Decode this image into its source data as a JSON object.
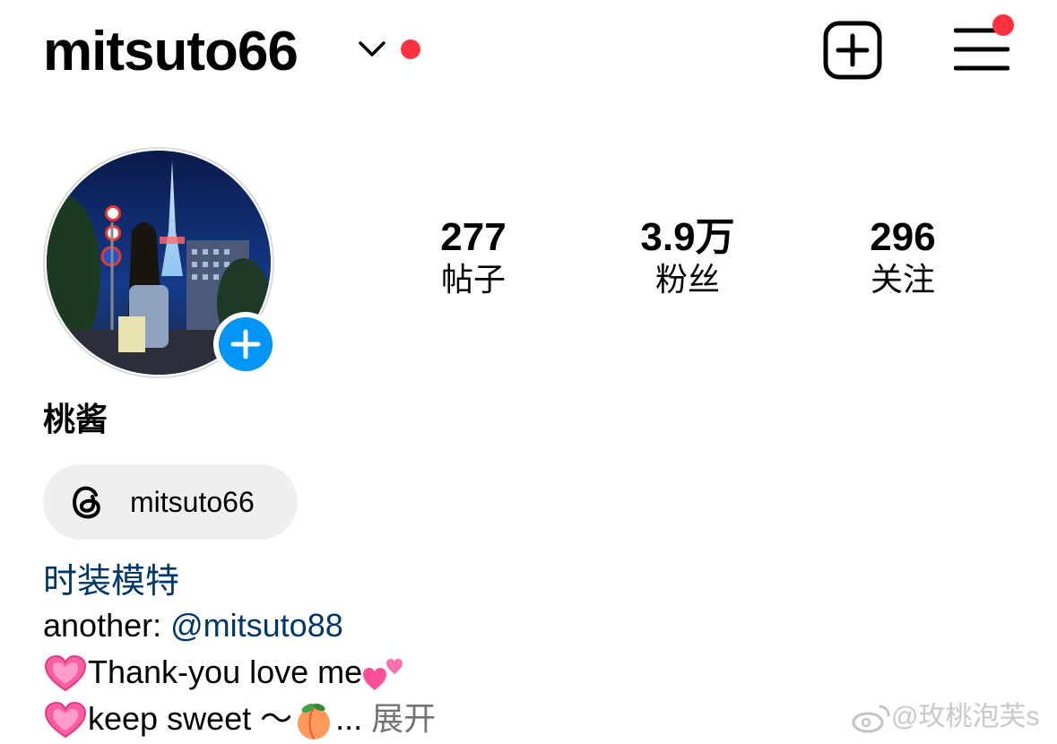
{
  "header": {
    "username": "mitsuto66",
    "dropdown_icon": "chevron-down-icon",
    "notification_dot_color": "#ff3040",
    "create_icon": "add-square-icon",
    "menu_icon": "hamburger-menu-icon"
  },
  "profile": {
    "avatar_add_icon": "plus-icon",
    "stats": [
      {
        "value": "277",
        "label": "帖子"
      },
      {
        "value": "3.9万",
        "label": "粉丝"
      },
      {
        "value": "296",
        "label": "关注"
      }
    ],
    "display_name": "桃酱",
    "threads": {
      "icon": "threads-icon",
      "handle": "mitsuto66"
    },
    "category": "时装模特",
    "bio": {
      "line1_prefix": "another: ",
      "line1_mention": "@mitsuto88",
      "line2_text": "Thank-you love me",
      "line3_text": "keep sweet ～",
      "line3_ellipsis": "... ",
      "more_label": "展开"
    }
  },
  "watermark": "@玫桃泡芙s",
  "colors": {
    "accent_blue": "#0095f6",
    "link_blue": "#00376b",
    "pill_bg": "#efefef"
  }
}
